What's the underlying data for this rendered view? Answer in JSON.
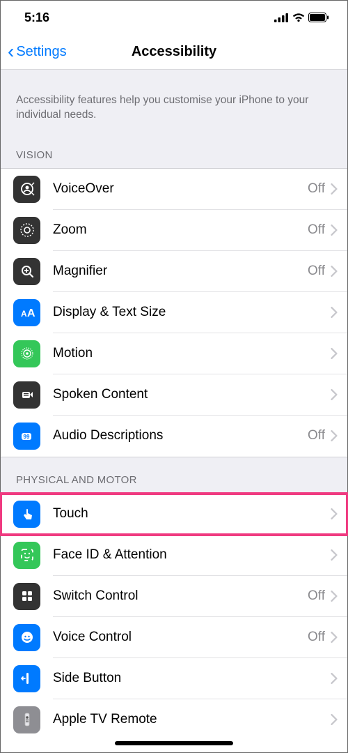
{
  "status": {
    "time": "5:16"
  },
  "nav": {
    "back_label": "Settings",
    "title": "Accessibility"
  },
  "intro": "Accessibility features help you customise your iPhone to your individual needs.",
  "sections": {
    "vision": {
      "header": "VISION",
      "items": [
        {
          "label": "VoiceOver",
          "value": "Off",
          "icon": "voiceover",
          "bg": "bg-black"
        },
        {
          "label": "Zoom",
          "value": "Off",
          "icon": "zoom",
          "bg": "bg-black"
        },
        {
          "label": "Magnifier",
          "value": "Off",
          "icon": "magnifier",
          "bg": "bg-black"
        },
        {
          "label": "Display & Text Size",
          "value": "",
          "icon": "textsize",
          "bg": "bg-blue"
        },
        {
          "label": "Motion",
          "value": "",
          "icon": "motion",
          "bg": "bg-green"
        },
        {
          "label": "Spoken Content",
          "value": "",
          "icon": "spoken",
          "bg": "bg-black"
        },
        {
          "label": "Audio Descriptions",
          "value": "Off",
          "icon": "audiodesc",
          "bg": "bg-blue"
        }
      ]
    },
    "physical": {
      "header": "PHYSICAL AND MOTOR",
      "items": [
        {
          "label": "Touch",
          "value": "",
          "icon": "touch",
          "bg": "bg-blue",
          "highlight": true
        },
        {
          "label": "Face ID & Attention",
          "value": "",
          "icon": "faceid",
          "bg": "bg-green"
        },
        {
          "label": "Switch Control",
          "value": "Off",
          "icon": "switchcontrol",
          "bg": "bg-black"
        },
        {
          "label": "Voice Control",
          "value": "Off",
          "icon": "voicecontrol",
          "bg": "bg-blue"
        },
        {
          "label": "Side Button",
          "value": "",
          "icon": "sidebutton",
          "bg": "bg-blue"
        },
        {
          "label": "Apple TV Remote",
          "value": "",
          "icon": "remote",
          "bg": "bg-gray"
        }
      ]
    }
  }
}
